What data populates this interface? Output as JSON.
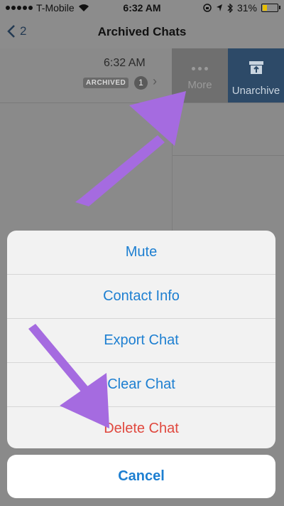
{
  "status_bar": {
    "carrier": "T-Mobile",
    "time": "6:32 AM",
    "battery": "31%"
  },
  "nav": {
    "back_count": "2",
    "title": "Archived Chats"
  },
  "chat_row": {
    "time": "6:32 AM",
    "archived_badge": "ARCHIVED",
    "unread_count": "1"
  },
  "swipe_actions": {
    "more_label": "More",
    "unarchive_label": "Unarchive"
  },
  "action_sheet": {
    "options": [
      {
        "label": "Mute"
      },
      {
        "label": "Contact Info"
      },
      {
        "label": "Export Chat"
      },
      {
        "label": "Clear Chat"
      },
      {
        "label": "Delete Chat"
      }
    ],
    "cancel_label": "Cancel"
  },
  "colors": {
    "accent": "#1d7fd1",
    "destructive": "#e0483e",
    "unarchive_bg": "#2d4a68",
    "annotation_arrow": "#a56be0"
  }
}
